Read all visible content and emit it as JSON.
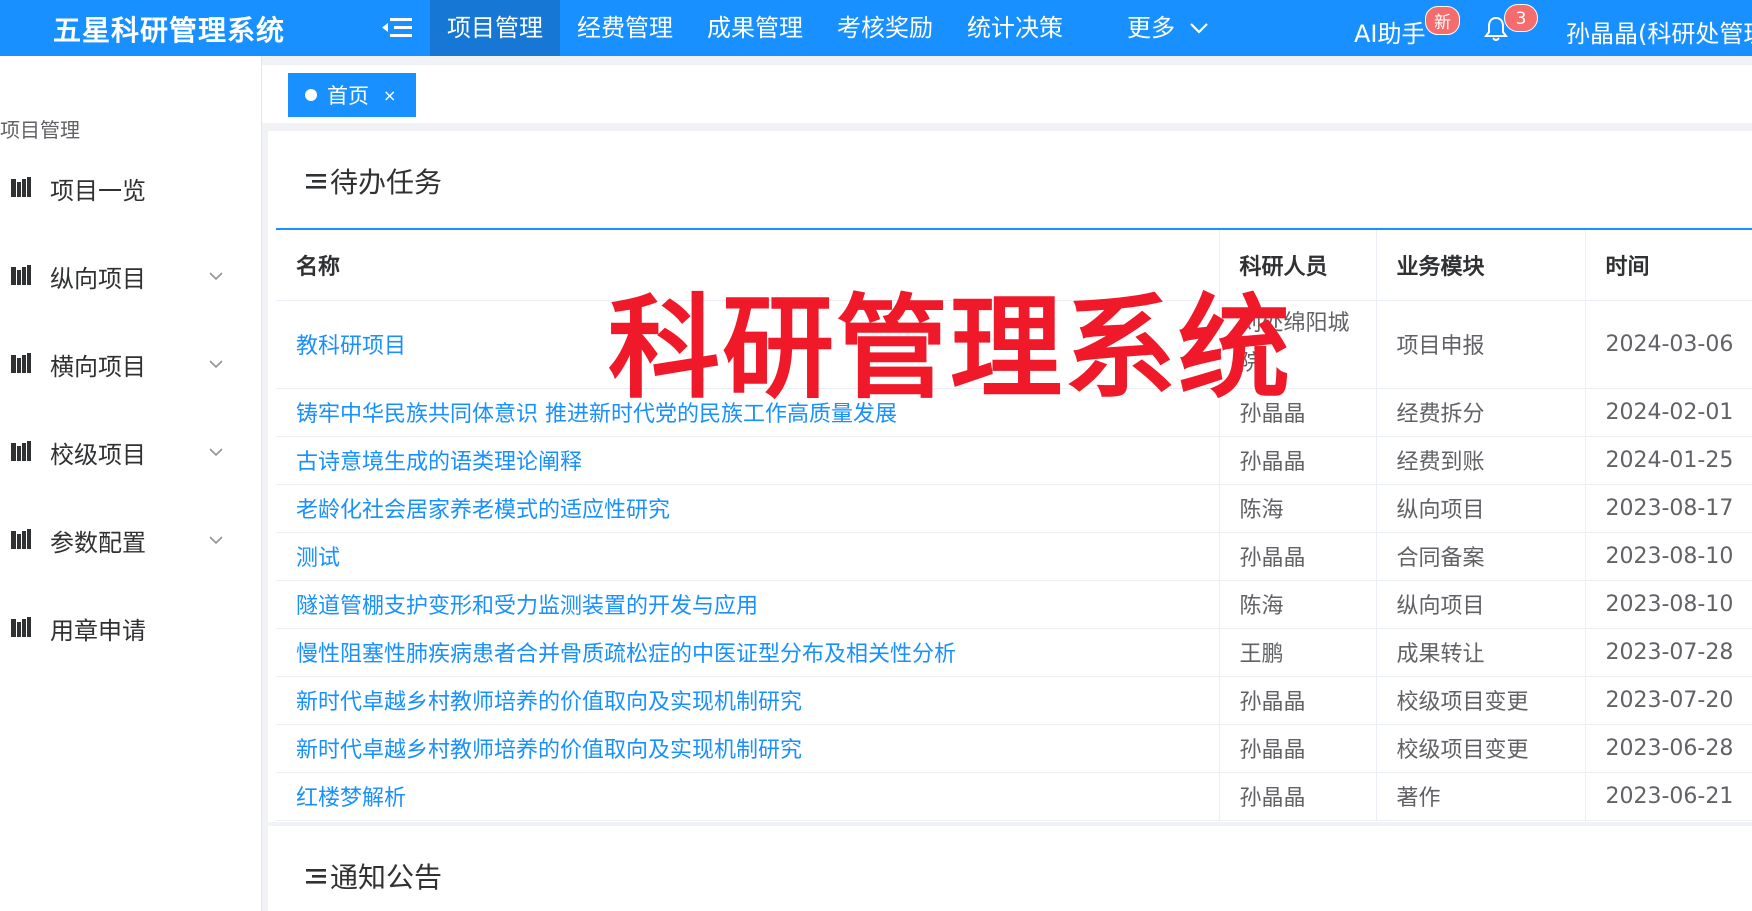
{
  "header": {
    "logo": "五星科研管理系统",
    "nav": [
      "项目管理",
      "经费管理",
      "成果管理",
      "考核奖励",
      "统计决策"
    ],
    "active_nav": "项目管理",
    "more": "更多",
    "ai": "AI助手",
    "new_badge": "新",
    "notification_count": "3",
    "user": "孙晶晶(科研处管理员)"
  },
  "sidebar": {
    "title": "项目管理",
    "items": [
      {
        "label": "项目一览",
        "expandable": false
      },
      {
        "label": "纵向项目",
        "expandable": true
      },
      {
        "label": "横向项目",
        "expandable": true
      },
      {
        "label": "校级项目",
        "expandable": true
      },
      {
        "label": "参数配置",
        "expandable": true
      },
      {
        "label": "用章申请",
        "expandable": false
      }
    ]
  },
  "tabs": {
    "home": "首页",
    "close": "×"
  },
  "todo": {
    "title": "待办任务",
    "columns": [
      "名称",
      "科研人员",
      "业务模块",
      "时间"
    ],
    "rows": [
      {
        "name": "教科研项目",
        "person": "刘处绵阳城院",
        "module": "项目申报",
        "time": "2024-03-06"
      },
      {
        "name": "铸牢中华民族共同体意识 推进新时代党的民族工作高质量发展",
        "person": "孙晶晶",
        "module": "经费拆分",
        "time": "2024-02-01"
      },
      {
        "name": "古诗意境生成的语类理论阐释",
        "person": "孙晶晶",
        "module": "经费到账",
        "time": "2024-01-25"
      },
      {
        "name": "老龄化社会居家养老模式的适应性研究",
        "person": "陈海",
        "module": "纵向项目",
        "time": "2023-08-17"
      },
      {
        "name": "测试",
        "person": "孙晶晶",
        "module": "合同备案",
        "time": "2023-08-10"
      },
      {
        "name": "隧道管棚支护变形和受力监测装置的开发与应用",
        "person": "陈海",
        "module": "纵向项目",
        "time": "2023-08-10"
      },
      {
        "name": "慢性阻塞性肺疾病患者合并骨质疏松症的中医证型分布及相关性分析",
        "person": "王鹏",
        "module": "成果转让",
        "time": "2023-07-28"
      },
      {
        "name": "新时代卓越乡村教师培养的价值取向及实现机制研究",
        "person": "孙晶晶",
        "module": "校级项目变更",
        "time": "2023-07-20"
      },
      {
        "name": "新时代卓越乡村教师培养的价值取向及实现机制研究",
        "person": "孙晶晶",
        "module": "校级项目变更",
        "time": "2023-06-28"
      },
      {
        "name": "红楼梦解析",
        "person": "孙晶晶",
        "module": "著作",
        "time": "2023-06-21"
      }
    ]
  },
  "notice": {
    "title": "通知公告"
  },
  "watermark": "科研管理系统",
  "colors": {
    "primary": "#1890ff",
    "badge": "#f56c6c",
    "watermark": "#f0192a"
  }
}
